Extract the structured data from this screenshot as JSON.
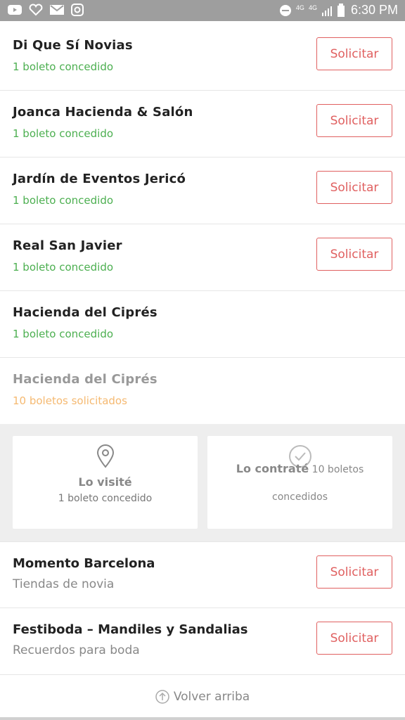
{
  "status_bar": {
    "icons_left": [
      "youtube-icon",
      "heart-icon",
      "gmail-icon",
      "instagram-icon"
    ],
    "network1": "4G",
    "network2": "4G",
    "time": "6:30 PM"
  },
  "vendors": [
    {
      "name": "Di Que Sí Novias",
      "status": "1 boleto concedido",
      "button": "Solicitar"
    },
    {
      "name": "Joanca Hacienda & Salón",
      "status": "1 boleto concedido",
      "button": "Solicitar"
    },
    {
      "name": "Jardín de Eventos Jericó",
      "status": "1 boleto concedido",
      "button": "Solicitar"
    },
    {
      "name": "Real San Javier",
      "status": "1 boleto concedido",
      "button": "Solicitar"
    },
    {
      "name": "Hacienda del Ciprés",
      "status": "1 boleto concedido"
    },
    {
      "name": "Hacienda del Ciprés",
      "status": "10 boletos solicitados"
    }
  ],
  "cards": {
    "visited": {
      "title": "Lo visité",
      "sub": "1 boleto concedido"
    },
    "hired": {
      "title": "Lo contraté",
      "sub_a": "10 boletos",
      "sub_b": "concedidos"
    }
  },
  "suggestions": [
    {
      "name": "Momento Barcelona",
      "category": "Tiendas de novia",
      "button": "Solicitar"
    },
    {
      "name": "Festiboda – Mandiles y Sandalias",
      "category": "Recuerdos para boda",
      "button": "Solicitar"
    }
  ],
  "back_to_top": "Volver arriba",
  "colors": {
    "accent": "#e06060",
    "granted": "#4caf50",
    "requested": "#f5b971"
  }
}
